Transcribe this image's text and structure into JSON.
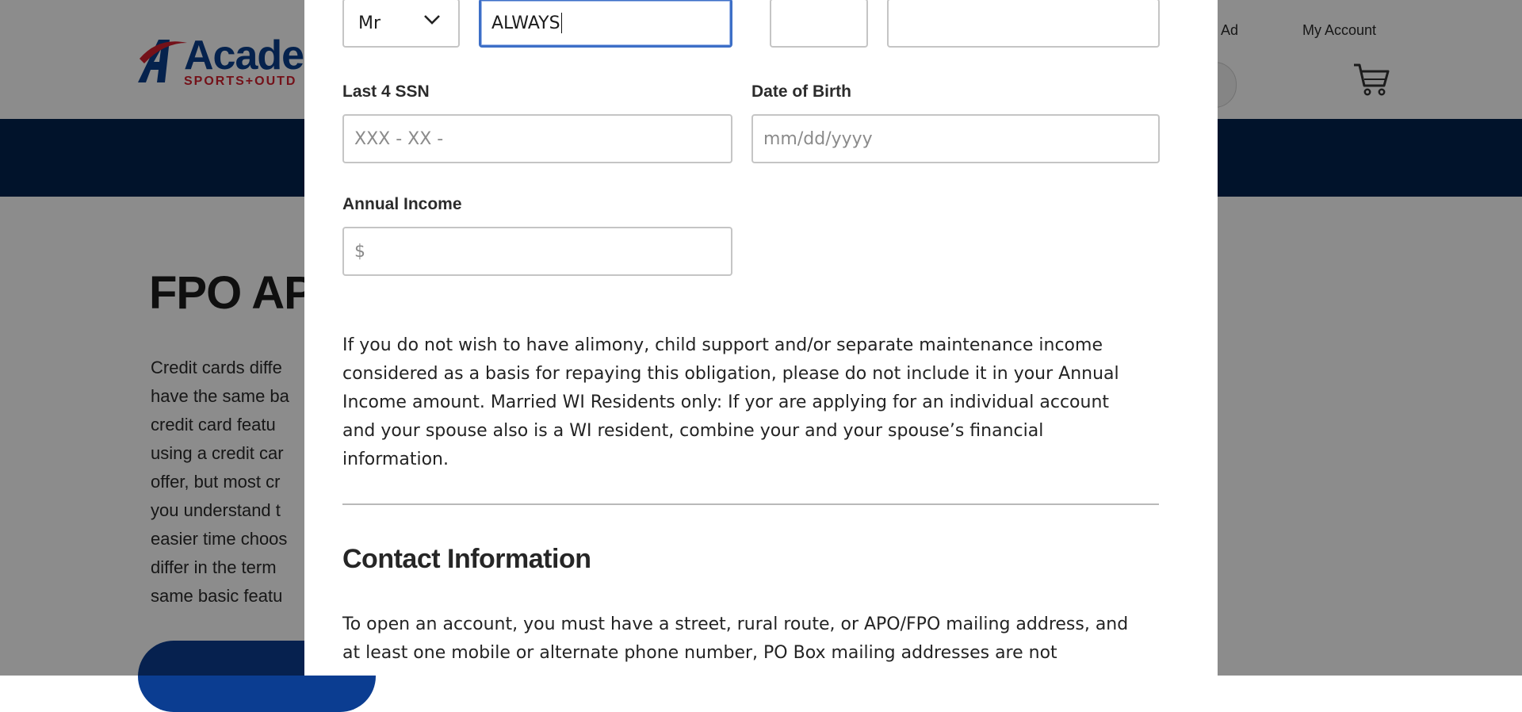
{
  "background_page": {
    "logo_text": "Acade",
    "logo_sub": "SPORTS+OUTD",
    "header_links": [
      "tly Ad",
      "My Account"
    ],
    "hero_title": "FPO API",
    "body_lines": [
      "Credit cards diffe",
      "have the same ba",
      "credit card featu",
      "using a credit car",
      "offer, but most cr",
      "you understand t",
      "easier time choos",
      "differ in the term",
      "same basic featu"
    ]
  },
  "modal": {
    "title_select": {
      "value": "Mr",
      "icon": "chevron-down-icon"
    },
    "first_name": {
      "value": "ALWAYS"
    },
    "middle_initial": {
      "value": ""
    },
    "last_name": {
      "value": ""
    },
    "ssn": {
      "label": "Last 4 SSN",
      "placeholder": "XXX - XX -"
    },
    "dob": {
      "label": "Date of Birth",
      "placeholder": "mm/dd/yyyy"
    },
    "income": {
      "label": "Annual Income",
      "placeholder": "$"
    },
    "disclosure_lines": [
      "If you do not wish to have alimony, child support and/or separate maintenance income",
      "considered as a basis for repaying this obligation, please do not include it in your Annual",
      "Income amount. Married WI Residents only: If yor are applying for an individual account",
      "and your spouse also is a WI resident, combine your and your spouse’s financial",
      "information."
    ],
    "contact_heading": "Contact Information",
    "contact_lines": [
      "To open an account, you must have a street, rural route, or APO/FPO mailing address, and",
      "at least one mobile or alternate phone number, PO Box mailing addresses are not"
    ]
  },
  "colors": {
    "nav_band": "#03244f",
    "focus_border": "#3d6fc7",
    "logo_blue": "#0a3f8c",
    "logo_red": "#d3202e"
  }
}
